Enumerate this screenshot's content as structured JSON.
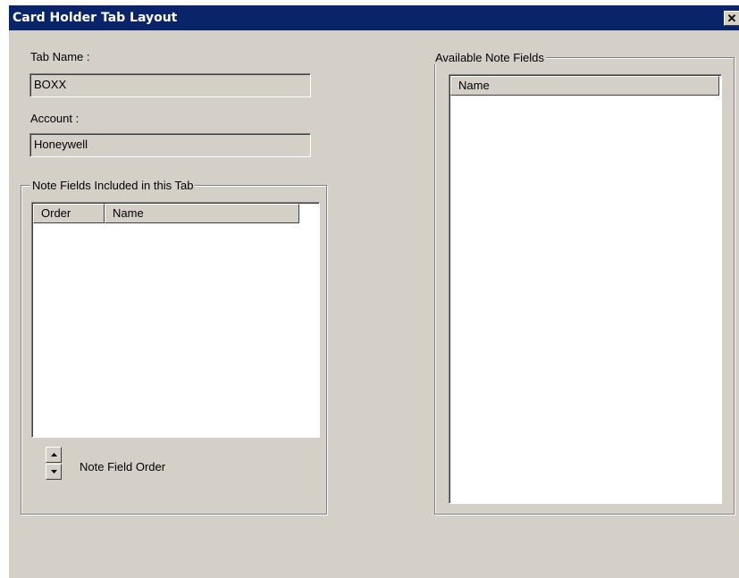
{
  "window": {
    "title": "Card Holder Tab Layout",
    "close_glyph": "✕"
  },
  "form": {
    "tab_name_label": "Tab Name :",
    "tab_name_value": "BOXX",
    "account_label": "Account :",
    "account_value": "Honeywell"
  },
  "included_fields": {
    "group_label": "Note Fields Included in this Tab",
    "columns": [
      "Order",
      "Name"
    ],
    "rows": [],
    "order_label": "Note Field Order"
  },
  "available_fields": {
    "group_label": "Available Note Fields",
    "columns": [
      "Name"
    ],
    "rows": []
  },
  "colors": {
    "titlebar": "#0a246a",
    "dialog_face": "#d4d0c8",
    "list_background": "#ffffff"
  },
  "icons": {
    "close": "close-icon",
    "up": "arrow-up-icon",
    "down": "arrow-down-icon"
  }
}
